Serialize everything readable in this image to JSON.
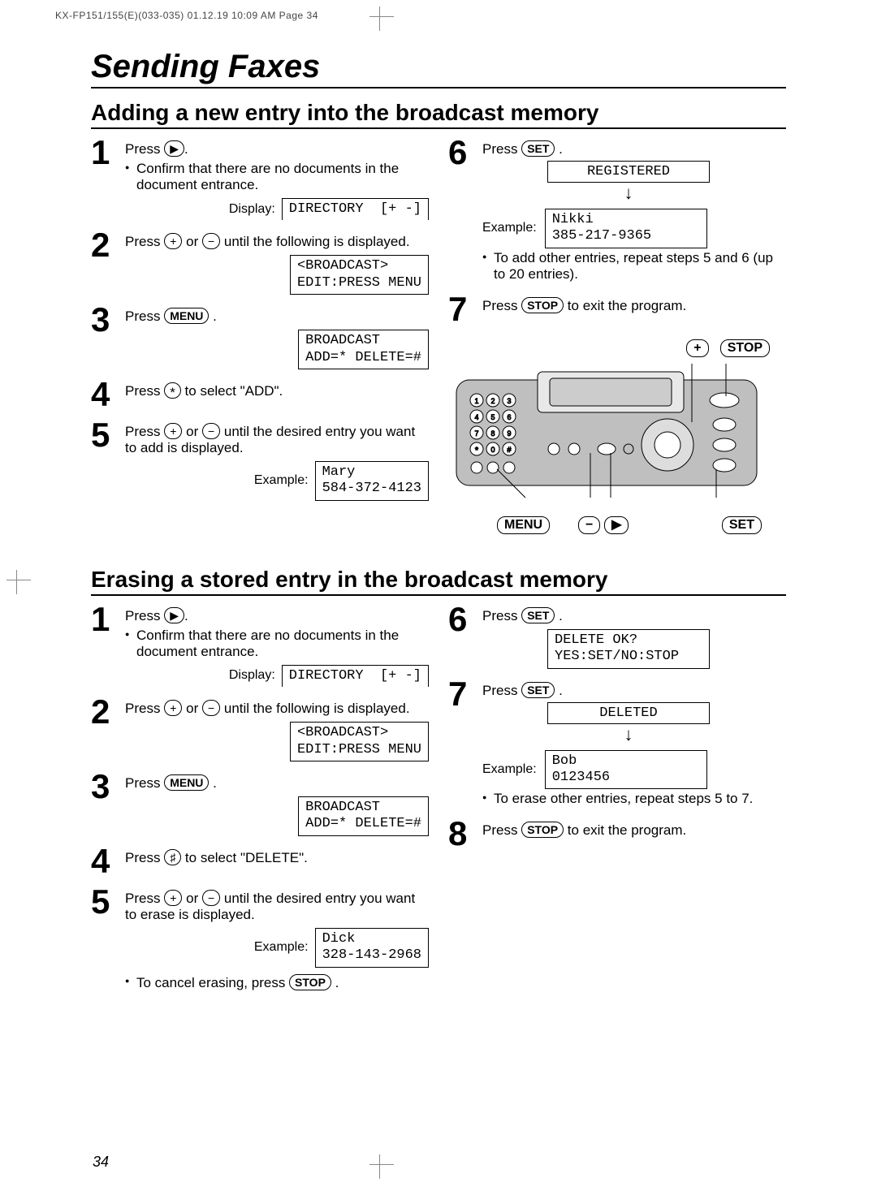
{
  "page_header": "KX-FP151/155(E)(033-035)  01.12.19 10:09 AM  Page 34",
  "chapter": "Sending Faxes",
  "page_number": "34",
  "section_add": {
    "title": "Adding a new entry into the broadcast memory",
    "step1": {
      "press_label": "Press ",
      "bullet": "Confirm that there are no documents in the document entrance.",
      "display_label": "Display:",
      "display_value": "DIRECTORY  [+ -]"
    },
    "step2": {
      "text_a": "Press ",
      "text_b": " or ",
      "text_c": " until the following is displayed.",
      "display_value": "<BROADCAST>\nEDIT:PRESS MENU"
    },
    "step3": {
      "text_a": "Press ",
      "menu_key": "MENU",
      "period": ".",
      "display_value": "BROADCAST\nADD=* DELETE=#"
    },
    "step4": {
      "text_a": "Press ",
      "text_b": " to select \"ADD\"."
    },
    "step5": {
      "text_a": "Press ",
      "text_b": " or ",
      "text_c": " until the desired entry you want to add is displayed.",
      "example_label": "Example:",
      "example_value": "Mary\n584-372-4123"
    },
    "step6": {
      "text_a": "Press ",
      "set_key": "SET",
      "period": ".",
      "registered": "REGISTERED",
      "example_label": "Example:",
      "example_value": "Nikki\n385-217-9365",
      "bullet": "To add other entries, repeat steps 5 and 6 (up to 20 entries)."
    },
    "step7": {
      "text_a": "Press ",
      "stop_key": "STOP",
      "text_b": " to exit the program."
    },
    "callouts": {
      "plus": "+",
      "stop": "STOP",
      "menu": "MENU",
      "minus": "−",
      "next": "▶",
      "set": "SET"
    }
  },
  "section_erase": {
    "title": "Erasing a stored entry in the broadcast memory",
    "step1": {
      "press_label": "Press ",
      "bullet": "Confirm that there are no documents in the document entrance.",
      "display_label": "Display:",
      "display_value": "DIRECTORY  [+ -]"
    },
    "step2": {
      "text_a": "Press ",
      "text_b": " or ",
      "text_c": " until the following is displayed.",
      "display_value": "<BROADCAST>\nEDIT:PRESS MENU"
    },
    "step3": {
      "text_a": "Press ",
      "menu_key": "MENU",
      "period": ".",
      "display_value": "BROADCAST\nADD=* DELETE=#"
    },
    "step4": {
      "text_a": "Press ",
      "text_b": " to select \"DELETE\"."
    },
    "step5": {
      "text_a": "Press ",
      "text_b": " or ",
      "text_c": " until the desired entry you want to erase is displayed.",
      "example_label": "Example:",
      "example_value": "Dick\n328-143-2968",
      "bullet_a": "To cancel erasing, press ",
      "stop_key": "STOP",
      "bullet_b": "."
    },
    "step6": {
      "text_a": "Press ",
      "set_key": "SET",
      "period": ".",
      "display_value": "DELETE OK?\nYES:SET/NO:STOP"
    },
    "step7": {
      "text_a": "Press ",
      "set_key": "SET",
      "period": ".",
      "deleted": "DELETED",
      "example_label": "Example:",
      "example_value": "Bob\n0123456",
      "bullet": "To erase other entries, repeat steps 5 to 7."
    },
    "step8": {
      "text_a": "Press ",
      "stop_key": "STOP",
      "text_b": " to exit the program."
    }
  }
}
